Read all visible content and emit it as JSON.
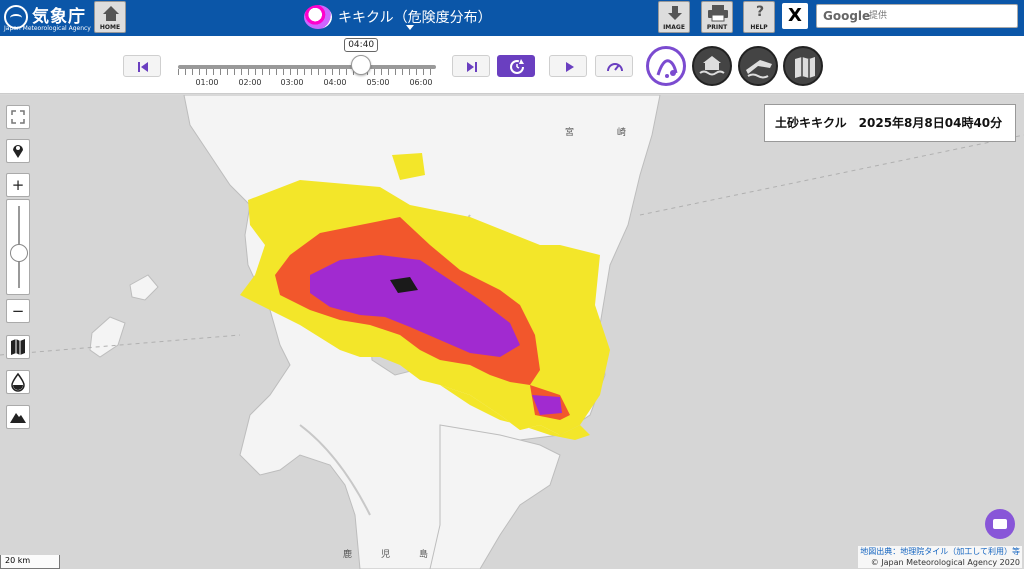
{
  "header": {
    "logo_ja": "気象庁",
    "logo_en": "Japan Meteorological Agency",
    "home_label": "HOME",
    "title": "キキクル（危険度分布）",
    "tools": [
      {
        "name": "image",
        "label": "IMAGE",
        "icon": "download-icon"
      },
      {
        "name": "print",
        "label": "PRINT",
        "icon": "printer-icon"
      },
      {
        "name": "help",
        "label": "HELP",
        "icon": "question-icon"
      }
    ],
    "x_label": "X",
    "search": {
      "brand": "Google",
      "placeholder": "提供"
    }
  },
  "timeline": {
    "current_time": "04:40",
    "ticks": [
      "01:00",
      "02:00",
      "03:00",
      "04:00",
      "05:00",
      "06:00"
    ],
    "position_fraction": 0.71
  },
  "info_box": {
    "title": "土砂キキクル　2025年8月8日04時40分"
  },
  "map": {
    "place_labels": [
      "宮",
      "崎",
      "鹿",
      "児",
      "島"
    ],
    "scale_label": "20 km",
    "attribution_link": "地図出典：地理院タイル（加工して利用）等",
    "attribution_copyright": "© Japan Meteorological Agency 2020"
  },
  "colors": {
    "header": "#0b56a8",
    "accent": "#6a3fc0",
    "risk_yellow": "#f3e629",
    "risk_red": "#f2572c",
    "risk_purple": "#a12ad0",
    "risk_black": "#1a1a1a"
  }
}
